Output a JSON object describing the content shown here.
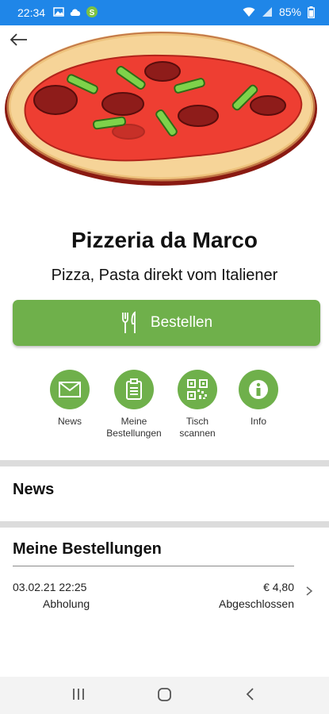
{
  "status_bar": {
    "time": "22:34",
    "battery": "85%"
  },
  "restaurant": {
    "name": "Pizzeria da Marco",
    "tagline": "Pizza, Pasta direkt vom Italiener"
  },
  "order_button": {
    "label": "Bestellen"
  },
  "quick_actions": [
    {
      "label": "News",
      "icon": "mail-icon"
    },
    {
      "label": "Meine\nBestellungen",
      "icon": "clipboard-icon"
    },
    {
      "label": "Tisch\nscannen",
      "icon": "qr-code-icon"
    },
    {
      "label": "Info",
      "icon": "info-icon"
    }
  ],
  "sections": {
    "news_title": "News",
    "orders_title": "Meine Bestellungen"
  },
  "orders": [
    {
      "date": "03.02.21 22:25",
      "type": "Abholung",
      "price": "€ 4,80",
      "status": "Abgeschlossen"
    }
  ],
  "colors": {
    "status_bar": "#1f86e8",
    "accent": "#6fb04b",
    "divider": "#dcdcdc"
  }
}
